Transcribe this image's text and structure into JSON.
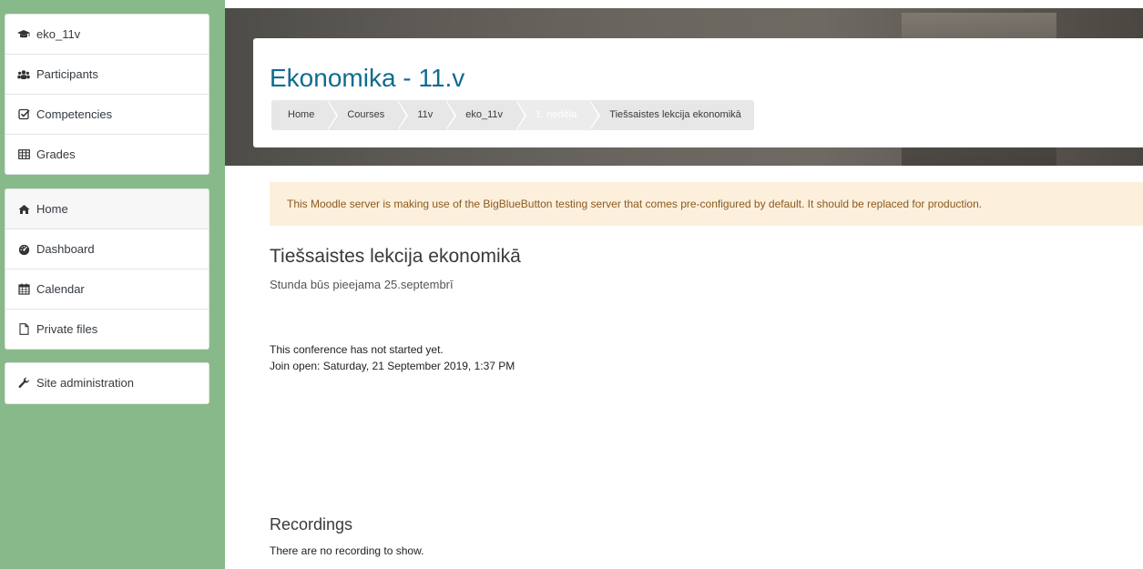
{
  "nav_course": [
    {
      "label": "eko_11v",
      "icon": "graduation-cap-icon"
    },
    {
      "label": "Participants",
      "icon": "users-icon"
    },
    {
      "label": "Competencies",
      "icon": "check-square-icon"
    },
    {
      "label": "Grades",
      "icon": "table-icon"
    }
  ],
  "nav_site": [
    {
      "label": "Home",
      "icon": "home-icon"
    },
    {
      "label": "Dashboard",
      "icon": "dashboard-icon"
    },
    {
      "label": "Calendar",
      "icon": "calendar-icon"
    },
    {
      "label": "Private files",
      "icon": "file-icon"
    }
  ],
  "nav_admin": {
    "label": "Site administration",
    "icon": "wrench-icon"
  },
  "header": {
    "title": "Ekonomika - 11.v",
    "breadcrumb": [
      "Home",
      "Courses",
      "11v",
      "eko_11v",
      "1. nedēļa",
      "Tiešsaistes lekcija ekonomikā"
    ]
  },
  "alert": "This Moodle server is making use of the BigBlueButton testing server that comes pre-configured by default. It should be replaced for production.",
  "activity": {
    "title": "Tiešsaistes lekcija ekonomikā",
    "description": "Stunda būs pieejama 25.septembrī",
    "status": "This conference has not started yet.",
    "join_open": "Join open: Saturday, 21 September 2019, 1:37 PM"
  },
  "recordings": {
    "title": "Recordings",
    "empty": "There are no recording to show."
  },
  "colors": {
    "drawer_bg": "#88b98a",
    "title_blue": "#0f6c91",
    "alert_bg": "#fcefdc",
    "alert_text": "#8a5b1d"
  }
}
